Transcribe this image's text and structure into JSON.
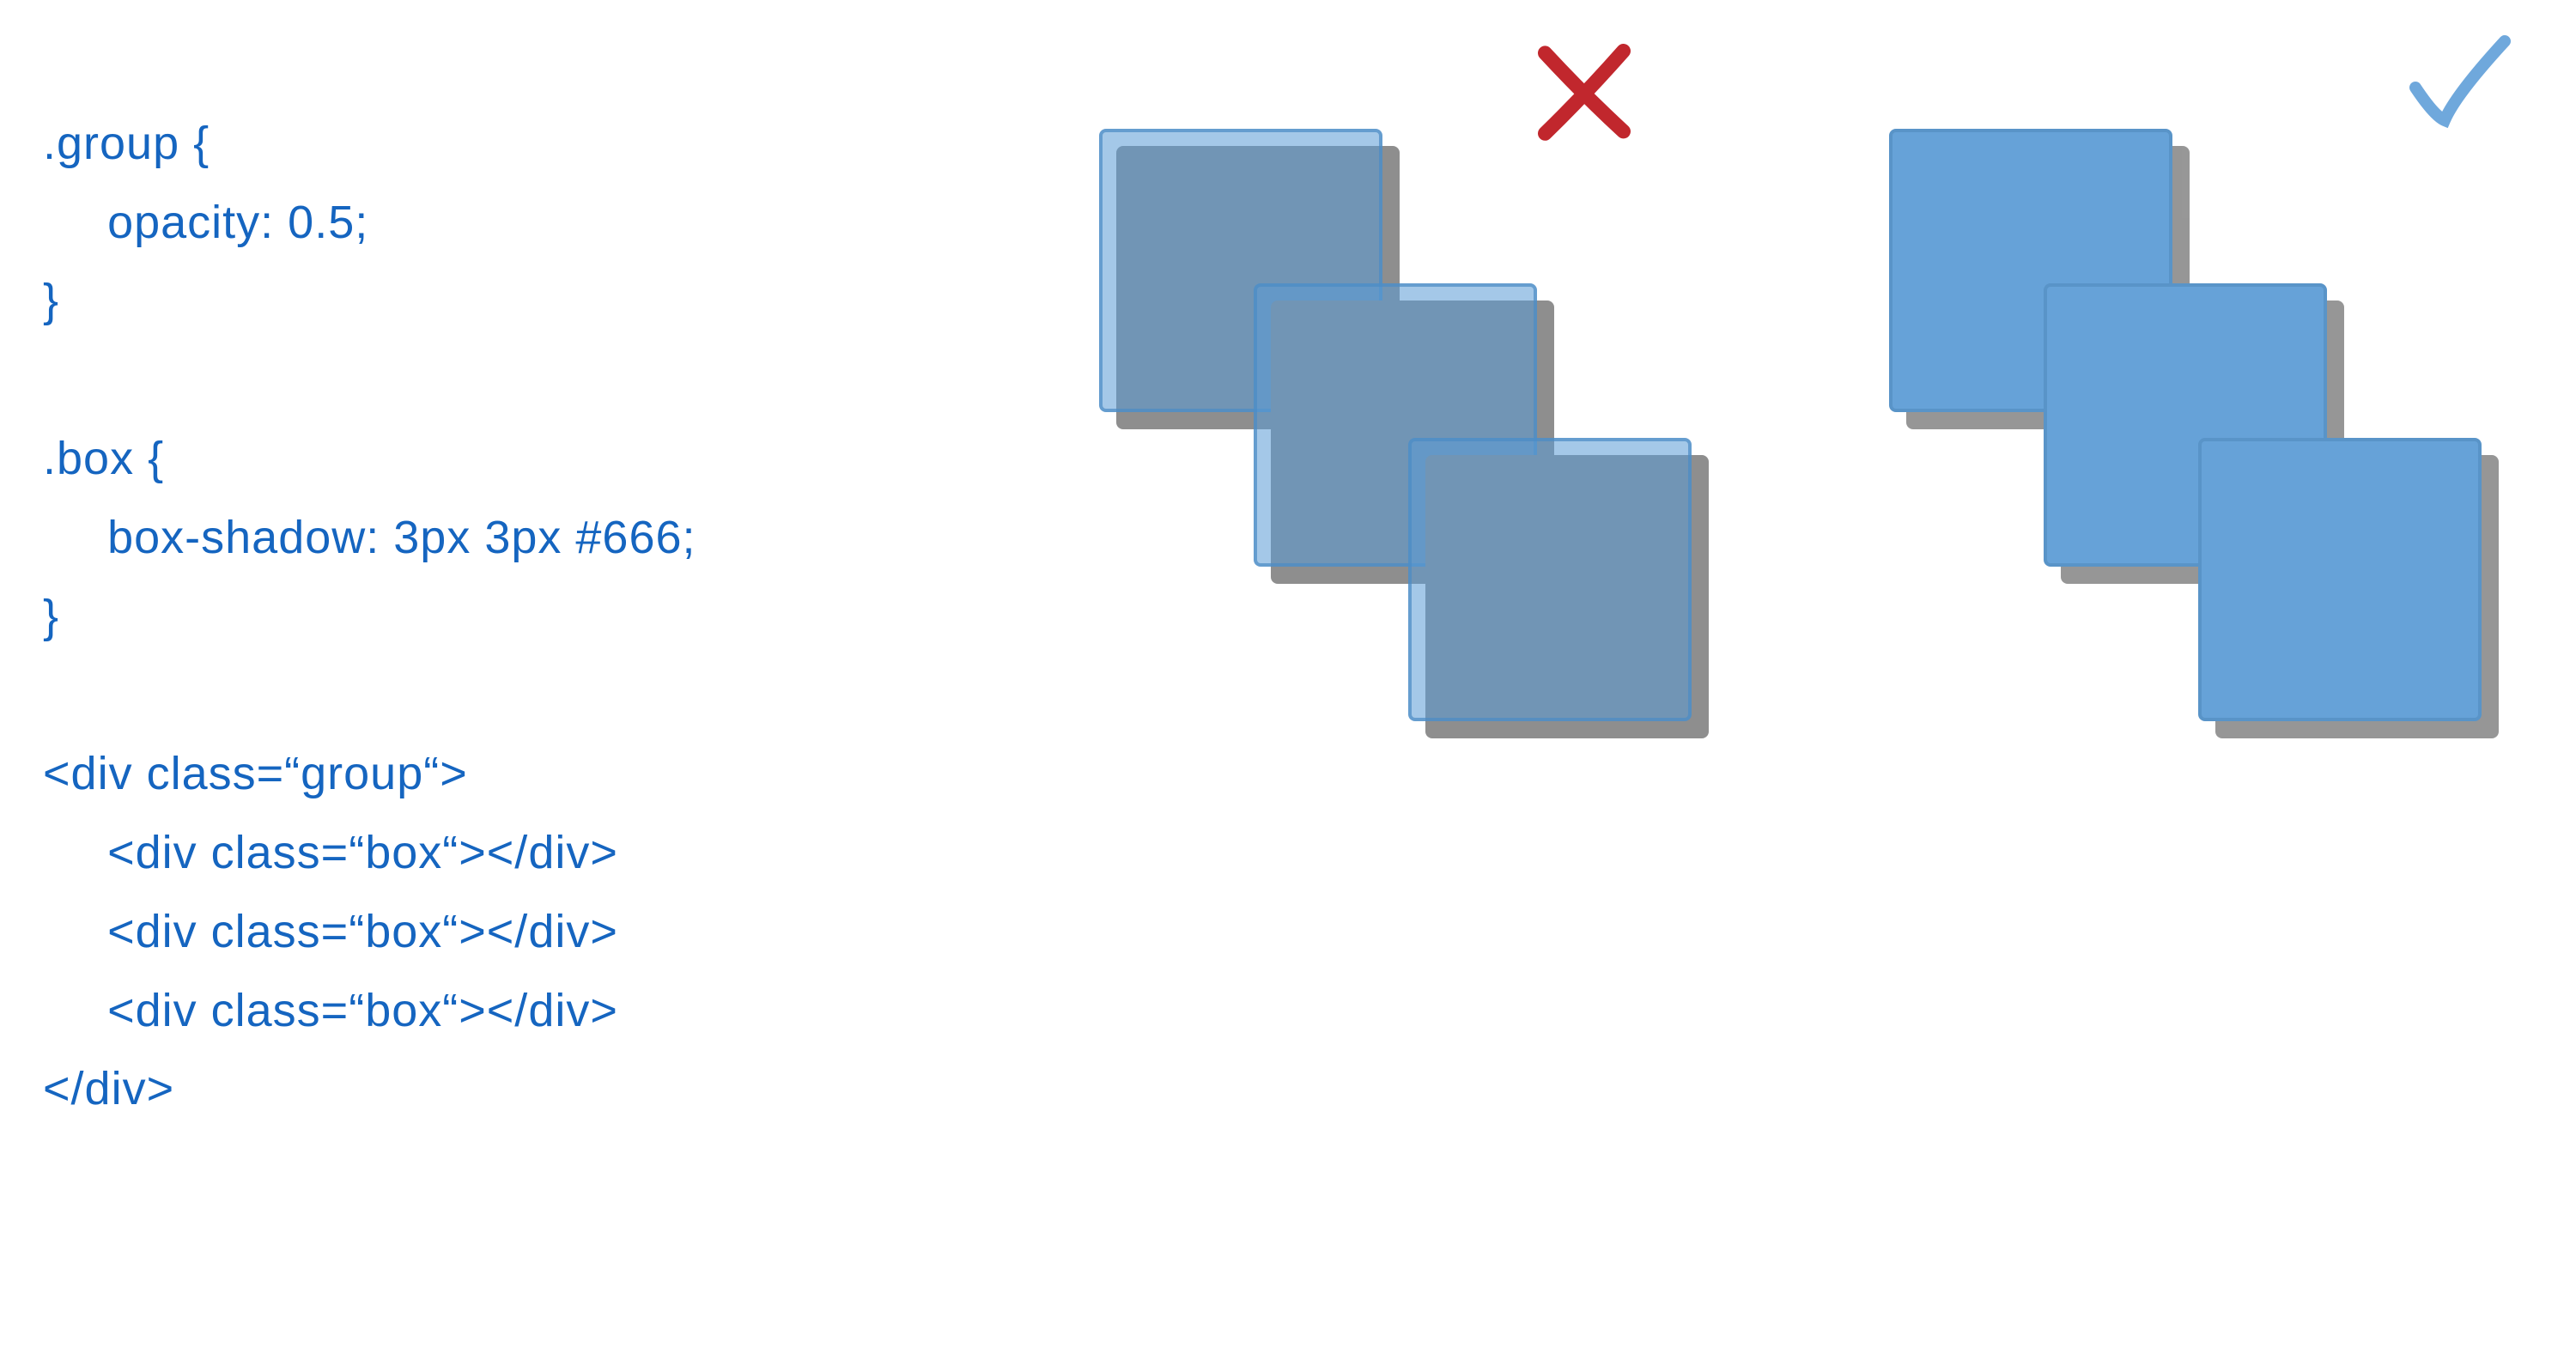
{
  "code": {
    "l1": ".group {",
    "l2": "opacity: 0.5;",
    "l3": "}",
    "l4": "",
    "l5": ".box {",
    "l6": "box-shadow: 3px 3px #666;",
    "l7": "}",
    "l8": "",
    "l9": "<div class=“group“>",
    "l10": "<div class=“box“></div>",
    "l11": "<div class=“box“></div>",
    "l12": "<div class=“box“></div>",
    "l13": "</div>"
  },
  "marks": {
    "wrong_color": "#C1272D",
    "right_color": "#6fa8dc"
  },
  "boxes": {
    "face_color": "#5a9bd5",
    "shadow_color": "#8e8e8e",
    "translucent_alpha": 0.55
  },
  "diagram": {
    "left_label": "incorrect-rendering",
    "right_label": "correct-rendering"
  }
}
